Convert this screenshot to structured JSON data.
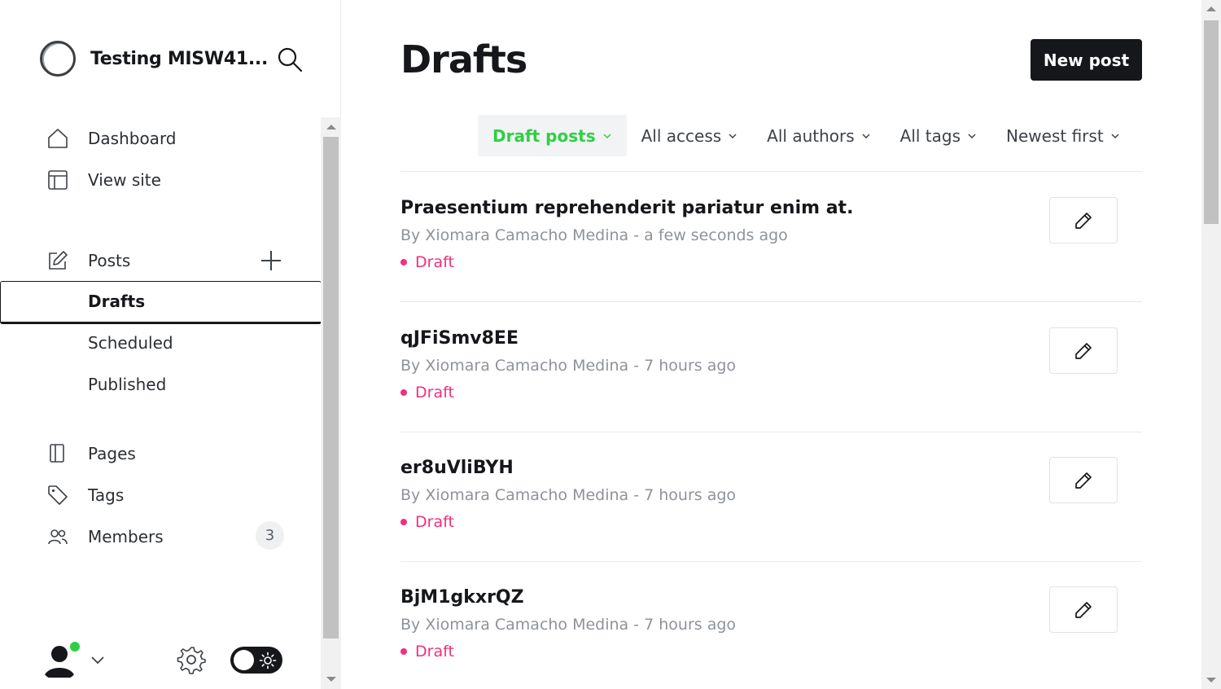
{
  "sidebar": {
    "site_title": "Testing MISW41...",
    "nav": {
      "dashboard": "Dashboard",
      "view_site": "View site",
      "posts": "Posts",
      "drafts": "Drafts",
      "scheduled": "Scheduled",
      "published": "Published",
      "pages": "Pages",
      "tags": "Tags",
      "members": "Members",
      "members_count": "3"
    }
  },
  "main": {
    "title": "Drafts",
    "new_post_label": "New post",
    "filters": [
      {
        "label": "Draft posts",
        "active": true
      },
      {
        "label": "All access",
        "active": false
      },
      {
        "label": "All authors",
        "active": false
      },
      {
        "label": "All tags",
        "active": false
      },
      {
        "label": "Newest first",
        "active": false
      }
    ],
    "posts": [
      {
        "title": "Praesentium reprehenderit pariatur enim at.",
        "meta": "By Xiomara Camacho Medina - a few seconds ago",
        "status": "Draft"
      },
      {
        "title": "qJFiSmv8EE",
        "meta": "By Xiomara Camacho Medina - 7 hours ago",
        "status": "Draft"
      },
      {
        "title": "er8uVliBYH",
        "meta": "By Xiomara Camacho Medina - 7 hours ago",
        "status": "Draft"
      },
      {
        "title": "BjM1gkxrQZ",
        "meta": "By Xiomara Camacho Medina - 7 hours ago",
        "status": "Draft"
      }
    ]
  },
  "colors": {
    "accent_green": "#30cf43",
    "draft_pink": "#f1307f",
    "dark": "#15171a"
  },
  "icons": {
    "search": "search-icon",
    "dashboard": "home-icon",
    "view_site": "layout-icon",
    "posts": "edit-icon",
    "pages": "page-icon",
    "tags": "tag-icon",
    "members": "members-icon",
    "settings": "gear-icon",
    "edit": "pencil-icon"
  }
}
